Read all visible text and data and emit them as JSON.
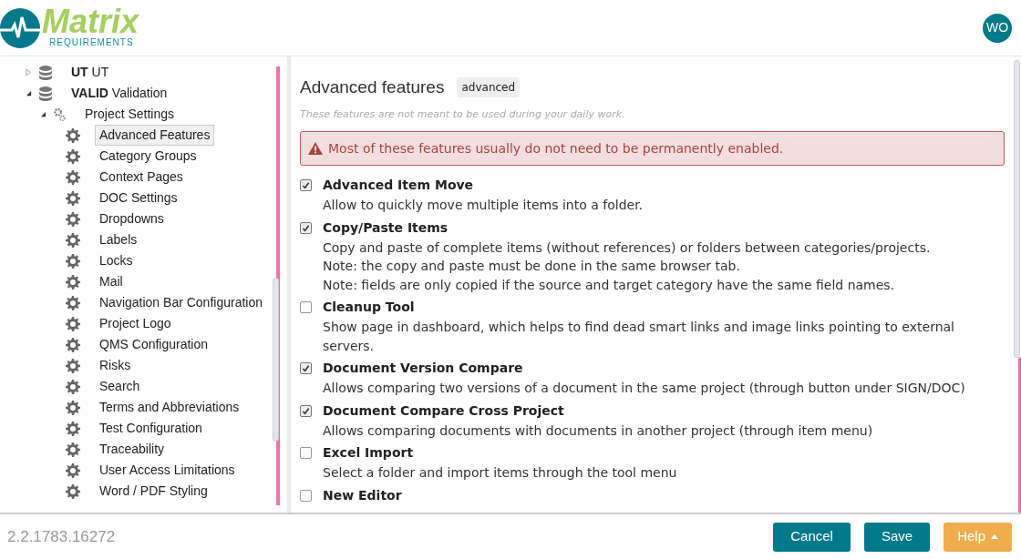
{
  "logo": {
    "name": "Matrix",
    "tagline": "REQUIREMENTS"
  },
  "user": {
    "initials": "WO"
  },
  "tree": [
    {
      "kind": "project",
      "label": "**UT** UT",
      "expanded": false,
      "selected": false
    },
    {
      "kind": "project",
      "label": "**VALID** Validation",
      "expanded": true,
      "selected": false,
      "children": [
        {
          "kind": "group",
          "label": "Project Settings",
          "expanded": true,
          "selected": false,
          "children": [
            {
              "kind": "setting",
              "label": "Advanced Features",
              "selected": true
            },
            {
              "kind": "setting",
              "label": "Category Groups",
              "selected": false
            },
            {
              "kind": "setting",
              "label": "Context Pages",
              "selected": false
            },
            {
              "kind": "setting",
              "label": "DOC Settings",
              "selected": false
            },
            {
              "kind": "setting",
              "label": "Dropdowns",
              "selected": false
            },
            {
              "kind": "setting",
              "label": "Labels",
              "selected": false
            },
            {
              "kind": "setting",
              "label": "Locks",
              "selected": false
            },
            {
              "kind": "setting",
              "label": "Mail",
              "selected": false
            },
            {
              "kind": "setting",
              "label": "Navigation Bar Configuration",
              "selected": false
            },
            {
              "kind": "setting",
              "label": "Project Logo",
              "selected": false
            },
            {
              "kind": "setting",
              "label": "QMS Configuration",
              "selected": false
            },
            {
              "kind": "setting",
              "label": "Risks",
              "selected": false
            },
            {
              "kind": "setting",
              "label": "Search",
              "selected": false
            },
            {
              "kind": "setting",
              "label": "Terms and Abbreviations",
              "selected": false
            },
            {
              "kind": "setting",
              "label": "Test Configuration",
              "selected": false
            },
            {
              "kind": "setting",
              "label": "Traceability",
              "selected": false
            },
            {
              "kind": "setting",
              "label": "User Access Limitations",
              "selected": false
            },
            {
              "kind": "setting",
              "label": "Word / PDF Styling",
              "selected": false
            }
          ]
        }
      ]
    }
  ],
  "page": {
    "title": "Advanced features",
    "badge": "advanced",
    "subtitle": "These features are not meant to be used during your daily work.",
    "warning": "Most of these features usually do not need to be permanently enabled."
  },
  "features": [
    {
      "name": "Advanced Item Move",
      "checked": true,
      "description": [
        "Allow to quickly move multiple items into a folder."
      ]
    },
    {
      "name": "Copy/Paste Items",
      "checked": true,
      "description": [
        "Copy and paste of complete items (without references) or folders between categories/projects.",
        "Note: the copy and paste must be done in the same browser tab.",
        "Note: fields are only copied if the source and target category have the same field names."
      ]
    },
    {
      "name": "Cleanup Tool",
      "checked": false,
      "description": [
        "Show page in dashboard, which helps to find dead smart links and image links pointing to external servers."
      ]
    },
    {
      "name": "Document Version Compare",
      "checked": true,
      "description": [
        "Allows comparing two versions of a document in the same project (through button under SIGN/DOC)"
      ]
    },
    {
      "name": "Document Compare Cross Project",
      "checked": true,
      "description": [
        "Allows comparing documents with documents in another project (through item menu)"
      ]
    },
    {
      "name": "Excel Import",
      "checked": false,
      "description": [
        "Select a folder and import items through the tool menu"
      ]
    },
    {
      "name": "New Editor",
      "checked": false
    }
  ],
  "footer": {
    "version": "2.2.1783.16272",
    "buttons": [
      {
        "kind": "primary",
        "label": "Cancel"
      },
      {
        "kind": "primary",
        "label": "Save"
      },
      {
        "kind": "dropdown",
        "label": "Help"
      }
    ]
  }
}
